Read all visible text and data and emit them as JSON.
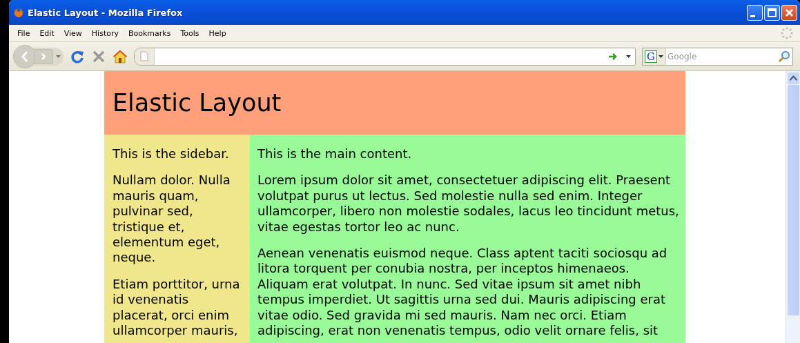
{
  "window": {
    "title": "Elastic Layout - Mozilla Firefox"
  },
  "menu": [
    "File",
    "Edit",
    "View",
    "History",
    "Bookmarks",
    "Tools",
    "Help"
  ],
  "toolbar": {
    "search": {
      "engine": "G",
      "placeholder": "Google"
    }
  },
  "page": {
    "heading": "Elastic Layout",
    "sidebar": [
      "This is the sidebar.",
      "Nullam dolor. Nulla mauris quam, pulvinar sed, tristique et, elementum eget, neque.",
      "Etiam porttitor, urna id venenatis placerat, orci enim ullamcorper mauris,"
    ],
    "main": [
      "This is the main content.",
      "Lorem ipsum dolor sit amet, consectetuer adipiscing elit. Praesent volutpat purus ut lectus. Sed molestie nulla sed enim. Integer ullamcorper, libero non molestie sodales, lacus leo tincidunt metus, vitae egestas tortor leo ac nunc.",
      "Aenean venenatis euismod neque. Class aptent taciti sociosqu ad litora torquent per conubia nostra, per inceptos himenaeos. Aliquam erat volutpat. In nunc. Sed vitae ipsum sit amet nibh tempus imperdiet. Ut sagittis urna sed dui. Mauris adipiscing erat vitae odio. Sed gravida mi sed mauris. Nam nec orci. Etiam adipiscing, erat non venenatis tempus, odio velit ornare felis, sit"
    ]
  }
}
